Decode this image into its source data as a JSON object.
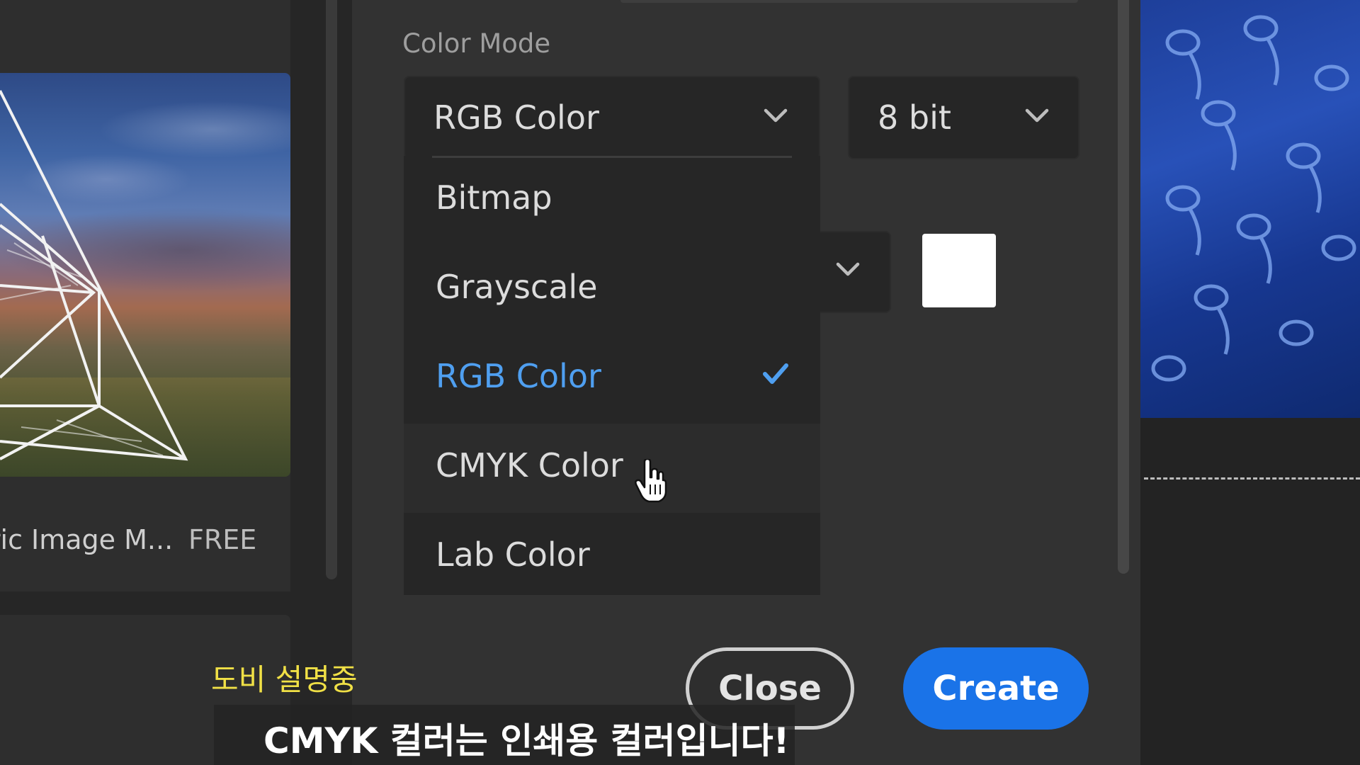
{
  "left_panel": {
    "template_name": "tric Image M...",
    "template_price": "FREE"
  },
  "dialog": {
    "section_label": "Color Mode",
    "color_mode_select": {
      "value": "RGB Color",
      "icon": "chevron-down-icon"
    },
    "bit_depth_select": {
      "value": "8 bit",
      "icon": "chevron-down-icon"
    },
    "background_select": {
      "icon": "chevron-down-icon"
    },
    "background_swatch_color": "#ffffff",
    "color_mode_options": [
      {
        "label": "Bitmap"
      },
      {
        "label": "Grayscale"
      },
      {
        "label": "RGB Color",
        "selected": true
      },
      {
        "label": "CMYK Color",
        "hovered": true
      },
      {
        "label": "Lab Color"
      }
    ],
    "close_label": "Close",
    "create_label": "Create",
    "accent_color": "#1a73e8"
  },
  "subtitles": {
    "speaker_tag": "도비 설명중",
    "caption": "CMYK 컬러는 인쇄용 컬러입니다!"
  }
}
